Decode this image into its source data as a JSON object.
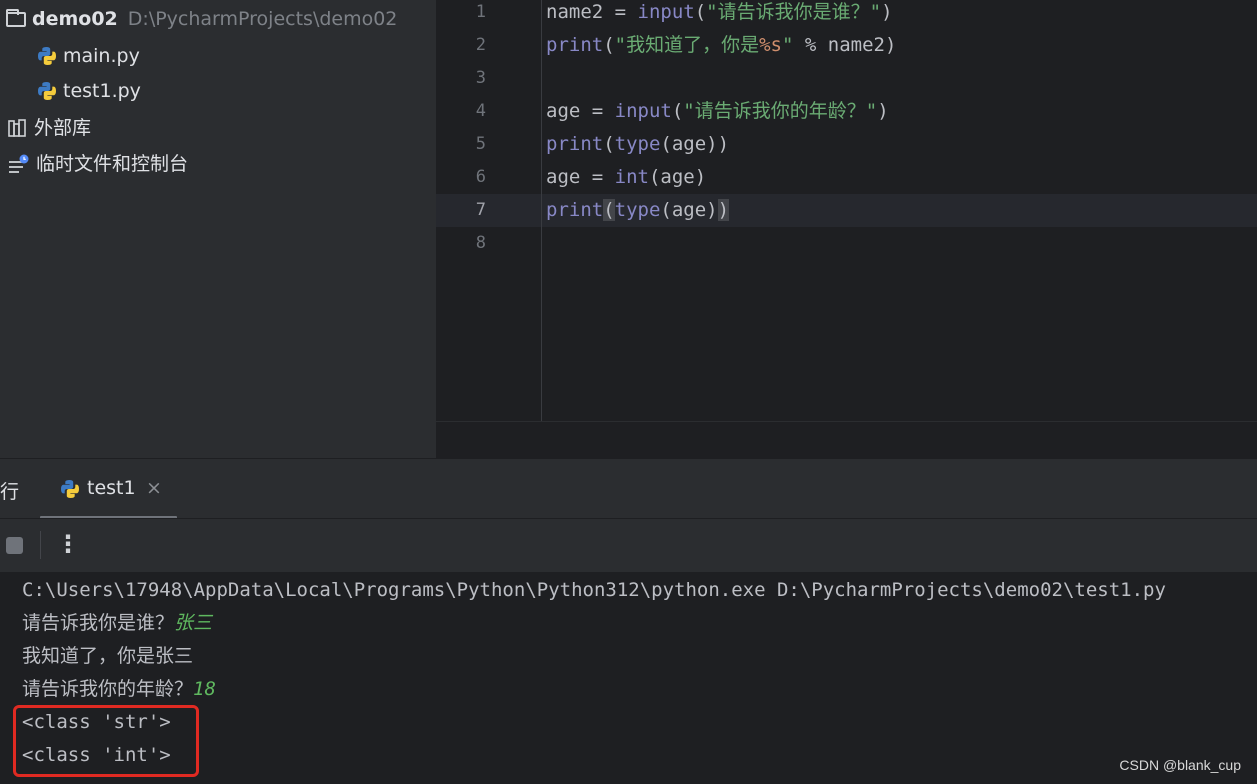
{
  "tree": {
    "root_name": "demo02",
    "root_path": "D:\\PycharmProjects\\demo02",
    "files": [
      "main.py",
      "test1.py"
    ],
    "external_libs": "外部库",
    "scratches": "临时文件和控制台"
  },
  "editor": {
    "line_numbers": [
      "1",
      "2",
      "3",
      "4",
      "5",
      "6",
      "7",
      "8"
    ],
    "lines": [
      {
        "a": "name2 = ",
        "k": "input",
        "b": "(",
        "s": "\"请告诉我你是谁？\"",
        "c": ")"
      },
      {
        "k": "print",
        "b": "(",
        "s1": "\"我知道了，你是",
        "f": "%s",
        "s2": "\"",
        "c": " % name2)"
      },
      {},
      {
        "a": "age = ",
        "k": "input",
        "b": "(",
        "s": "\"请告诉我你的年龄？\"",
        "c": ")"
      },
      {
        "k": "print",
        "b": "(",
        "k2": "type",
        "c": "(age))"
      },
      {
        "a": "age = ",
        "k": "int",
        "c": "(age)"
      },
      {
        "k": "print",
        "b": "(",
        "k2": "type",
        "c": "(age)",
        "d": ")"
      },
      {}
    ],
    "current_line": 7
  },
  "run": {
    "tool_label": "行",
    "tab_label": "test1",
    "close_glyph": "×",
    "more_glyph": "⋮"
  },
  "console": {
    "command": "C:\\Users\\17948\\AppData\\Local\\Programs\\Python\\Python312\\python.exe D:\\PycharmProjects\\demo02\\test1.py",
    "prompt1": "请告诉我你是谁？",
    "input1": "张三",
    "output1": "我知道了，你是张三",
    "prompt2": "请告诉我你的年龄？",
    "input2": "18",
    "output2": "<class 'str'>",
    "output3": "<class 'int'>"
  },
  "watermark": "CSDN @blank_cup",
  "colors": {
    "keyword": "#8888c6",
    "string": "#6aab73",
    "format": "#cf8e6d",
    "user_input": "#5fb85f",
    "highlight": "#e02a22"
  },
  "icons": {
    "folder": "folder-icon",
    "python_file": "python-file-icon",
    "library": "library-icon",
    "scratch": "scratch-console-icon",
    "stop": "stop-icon",
    "more": "more-vertical-icon",
    "close": "close-icon"
  }
}
